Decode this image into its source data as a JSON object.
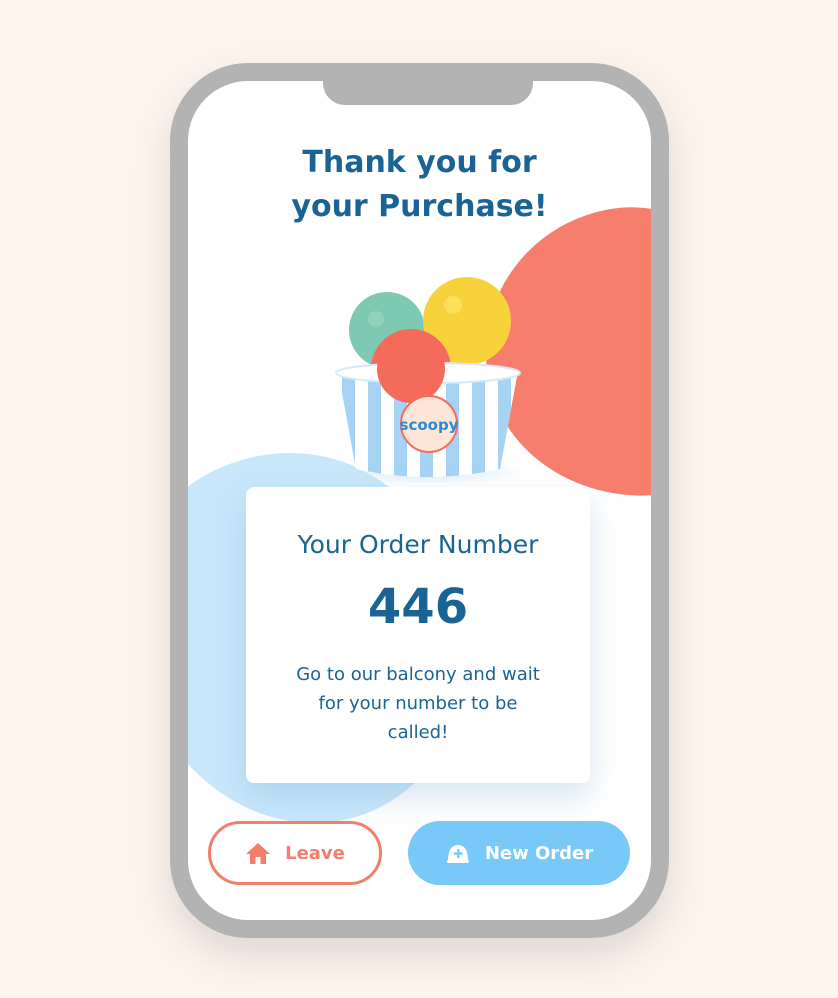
{
  "colors": {
    "background": "#fdf4ee",
    "primary_text": "#1a6495",
    "accent_red": "#f77e6c",
    "accent_blue": "#78c8f8",
    "blob_blue": "#c9e7fb"
  },
  "header": {
    "title_line1": "Thank you for",
    "title_line2": "your Purchase!"
  },
  "product": {
    "logo_text": "scoopy"
  },
  "order_card": {
    "heading": "Your Order Number",
    "number": "446",
    "message": "Go to our balcony and wait for your number to be called!"
  },
  "actions": {
    "leave": {
      "label": "Leave",
      "icon": "home-icon"
    },
    "new_order": {
      "label": "New Order",
      "icon": "ice-cream-add-icon"
    }
  }
}
